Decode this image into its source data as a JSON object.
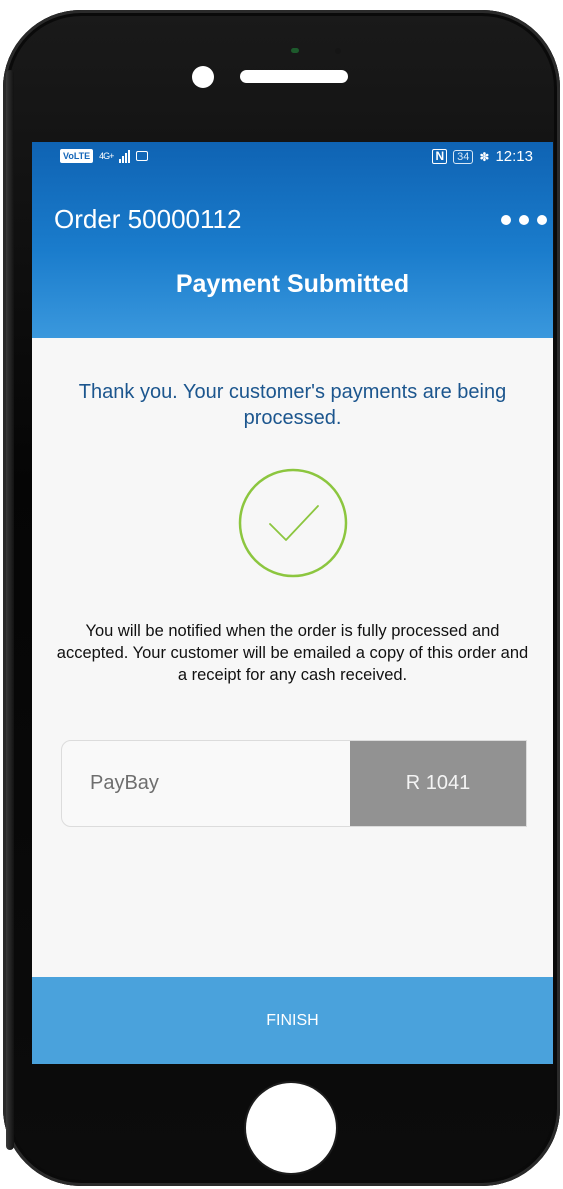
{
  "status_bar": {
    "volte": "VoLTE",
    "network": "4G+",
    "battery": "34",
    "time": "12:13"
  },
  "header": {
    "title": "Order 50000112",
    "heading": "Payment Submitted"
  },
  "main": {
    "thanks": "Thank you. Your customer's payments are being processed.",
    "notice": "You will be notified when the order is fully processed and accepted. Your customer will be emailed a copy of this order and a receipt for any cash received.",
    "payment": {
      "method": "PayBay",
      "amount": "R 1041"
    }
  },
  "footer": {
    "finish_label": "FINISH"
  },
  "colors": {
    "header_blue": "#1a7ccc",
    "finish_blue": "#4aa2dc",
    "success_green": "#8cc63f",
    "amount_gray": "#929292"
  },
  "icons": [
    "volte-icon",
    "signal-icon",
    "message-icon",
    "nfc-icon",
    "battery-icon",
    "leaf-icon",
    "more-icon",
    "check-icon"
  ]
}
